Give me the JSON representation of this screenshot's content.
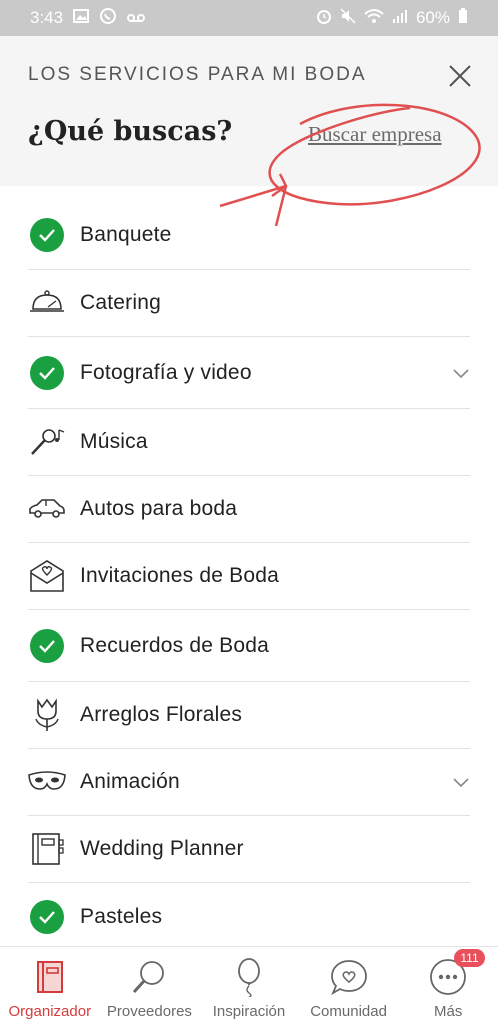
{
  "status_bar": {
    "time": "3:43",
    "battery": "60%"
  },
  "header": {
    "subtitle": "LOS SERVICIOS PARA MI BODA",
    "title": "¿Qué buscas?",
    "link": "Buscar empresa"
  },
  "services": [
    {
      "label": "Banquete",
      "selected": true,
      "icon": "check-icon"
    },
    {
      "label": "Catering",
      "selected": false,
      "icon": "serving-dish-icon"
    },
    {
      "label": "Fotografía y video",
      "selected": true,
      "icon": "check-icon",
      "expandable": true
    },
    {
      "label": "Música",
      "selected": false,
      "icon": "microphone-music-icon"
    },
    {
      "label": "Autos para boda",
      "selected": false,
      "icon": "car-icon"
    },
    {
      "label": "Invitaciones de Boda",
      "selected": false,
      "icon": "envelope-heart-icon"
    },
    {
      "label": "Recuerdos de Boda",
      "selected": true,
      "icon": "check-icon"
    },
    {
      "label": "Arreglos Florales",
      "selected": false,
      "icon": "tulip-icon"
    },
    {
      "label": "Animación",
      "selected": false,
      "icon": "mask-icon",
      "expandable": true
    },
    {
      "label": "Wedding Planner",
      "selected": false,
      "icon": "planner-book-icon"
    },
    {
      "label": "Pasteles",
      "selected": true,
      "icon": "check-icon"
    }
  ],
  "bottom_nav": [
    {
      "label": "Organizador",
      "icon": "organizer-book-icon",
      "active": true
    },
    {
      "label": "Proveedores",
      "icon": "magnifier-icon",
      "active": false
    },
    {
      "label": "Inspiración",
      "icon": "balloon-icon",
      "active": false
    },
    {
      "label": "Comunidad",
      "icon": "chat-heart-icon",
      "active": false
    },
    {
      "label": "Más",
      "icon": "more-dots-icon",
      "active": false,
      "badge": "111"
    }
  ],
  "colors": {
    "accent": "#d23c3c",
    "check": "#1aa041",
    "header_bg": "#f5f5f5",
    "annotation": "#e05050"
  }
}
